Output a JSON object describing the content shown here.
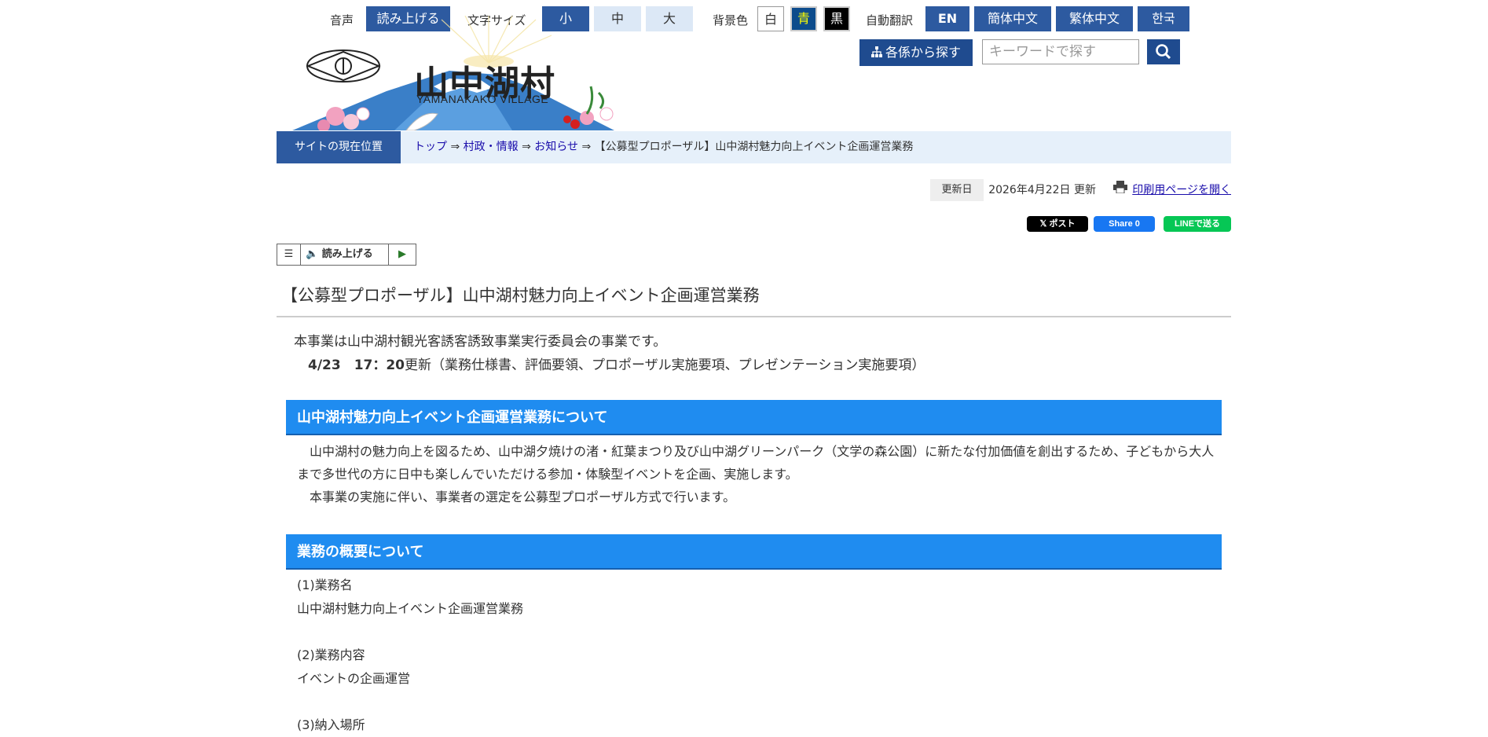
{
  "util": {
    "voice_label": "音声",
    "read_btn": "読み上げる",
    "fontsize_label": "文字サイズ",
    "size_small": "小",
    "size_mid": "中",
    "size_large": "大",
    "bg_label": "背景色",
    "bg_white": "白",
    "bg_blue": "青",
    "bg_black": "黒",
    "translate_label": "自動翻訳",
    "lang_en": "EN",
    "lang_zh_s": "簡体中文",
    "lang_zh_t": "繁体中文",
    "lang_ko": "한국"
  },
  "search": {
    "category_btn": "各係から探す",
    "placeholder": "キーワードで探す"
  },
  "logo": {
    "title": "山中湖村",
    "subtitle": "YAMANAKAKO VILLAGE"
  },
  "breadcrumb": {
    "label": "サイトの現在位置",
    "items": [
      "トップ",
      "村政・情報",
      "お知らせ"
    ],
    "sep": "⇒",
    "current": "【公募型プロポーザル】山中湖村魅力向上イベント企画運営業務"
  },
  "meta": {
    "updated_label": "更新日",
    "updated_value": "2026年4月22日 更新",
    "print_link": "印刷用ページを開く"
  },
  "social": {
    "x": "𝕏 ポスト",
    "facebook": "Share 0",
    "line": "LINEで送る"
  },
  "reader": {
    "read": "読み上げる"
  },
  "article": {
    "title": "【公募型プロポーザル】山中湖村魅力向上イベント企画運営業務",
    "intro1": "本事業は山中湖村観光客誘客誘致事業実行委員会の事業です。",
    "intro2_bold": "4/23　17：20",
    "intro2_rest": "更新（業務仕様書、評価要領、プロポーザル実施要項、プレゼンテーション実施要項）",
    "section1_title": "山中湖村魅力向上イベント企画運営業務について",
    "section1_p1": "　山中湖村の魅力向上を図るため、山中湖夕焼けの渚・紅葉まつり及び山中湖グリーンパーク（文学の森公園）に新たな付加価値を創出するため、子どもから大人まで多世代の方に日中も楽しんでいただける参加・体験型イベントを企画、実施します。",
    "section1_p2": "　本事業の実施に伴い、事業者の選定を公募型プロポーザル方式で行います。",
    "section2_title": "業務の概要について",
    "item1_head": "(1)業務名",
    "item1_body": "山中湖村魅力向上イベント企画運営業務",
    "item2_head": "(2)業務内容",
    "item2_body": "イベントの企画運営",
    "item3_head": "(3)納入場所"
  },
  "colors": {
    "header_blue": "#2d5aa0",
    "section_blue": "#1f8cf0",
    "link": "#1a0dab"
  }
}
